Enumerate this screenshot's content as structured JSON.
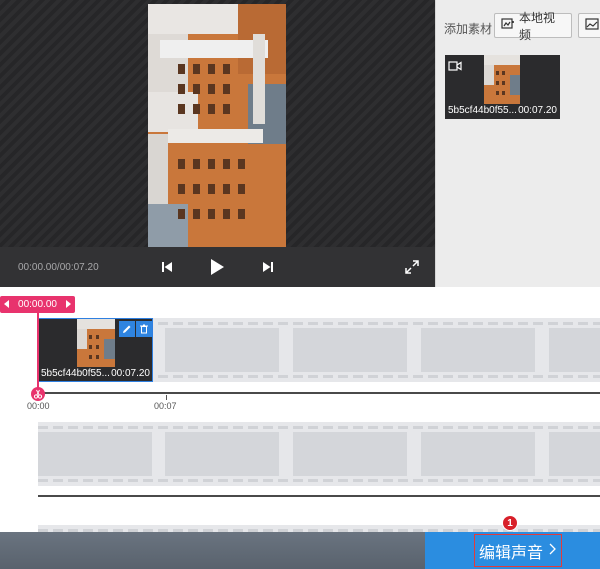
{
  "player": {
    "time_readout": "00:00.00/00:07.20",
    "icons": {
      "prev": "skip-back-icon",
      "play": "play-icon",
      "next": "skip-forward-icon",
      "fullscreen": "fullscreen-icon"
    }
  },
  "library": {
    "add_label": "添加素材",
    "local_video_label": "本地视频",
    "clip": {
      "name": "5b5cf44b0f55...",
      "duration": "00:07.20"
    }
  },
  "timeline": {
    "playhead_time": "00:00.00",
    "ruler": [
      "00:00",
      "00:07"
    ],
    "clip": {
      "name": "5b5cf44b0f55...",
      "duration": "00:07.20"
    }
  },
  "footer": {
    "next_label": "编辑声音",
    "step_number": "1"
  },
  "colors": {
    "accent_pink": "#e8336d",
    "accent_blue": "#2b8de0",
    "highlight_red": "#e23b3b"
  }
}
